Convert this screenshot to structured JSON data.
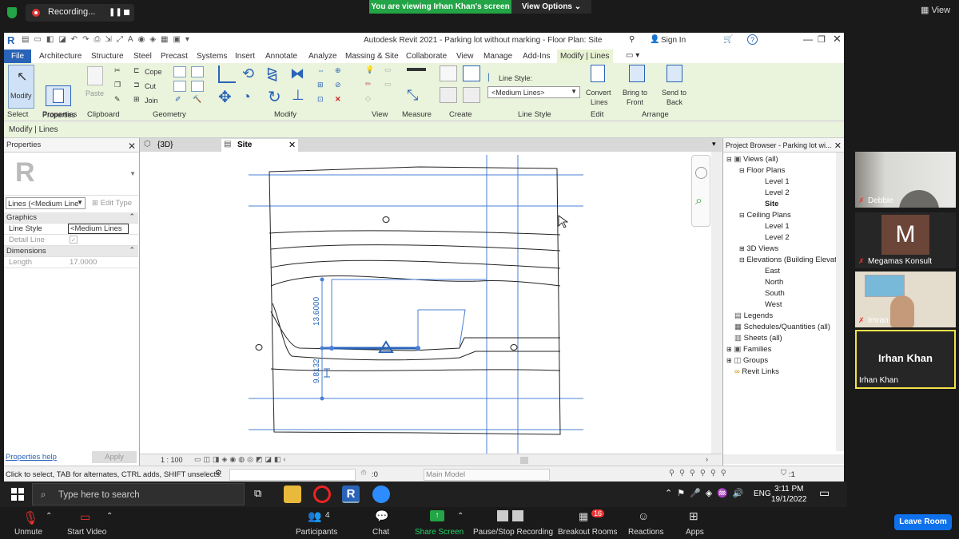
{
  "zoom": {
    "recording": "Recording...",
    "viewing_banner": "You are viewing Irhan Khan's screen",
    "view_options": "View Options",
    "view_label": "View",
    "leave_room": "Leave Room",
    "bottom": {
      "unmute": "Unmute",
      "start_video": "Start Video",
      "participants": "Participants",
      "participants_count": "4",
      "chat": "Chat",
      "share_screen": "Share Screen",
      "pause_stop": "Pause/Stop Recording",
      "breakout": "Breakout Rooms",
      "breakout_badge": "16",
      "reactions": "Reactions",
      "apps": "Apps"
    },
    "participants": [
      {
        "name": "Debbie",
        "avatar": ""
      },
      {
        "name": "Megamas Konsult",
        "avatar": "M"
      },
      {
        "name": "Imran",
        "avatar": ""
      },
      {
        "name": "Irhan Khan",
        "avatar": "Irhan Khan"
      }
    ]
  },
  "revit": {
    "title": "Autodesk Revit 2021 - Parking lot without marking - Floor Plan: Site",
    "sign_in": "Sign In",
    "tabs": [
      "File",
      "Architecture",
      "Structure",
      "Steel",
      "Precast",
      "Systems",
      "Insert",
      "Annotate",
      "Analyze",
      "Massing & Site",
      "Collaborate",
      "View",
      "Manage",
      "Add-Ins",
      "Modify | Lines"
    ],
    "ribbon": {
      "modify": "Modify",
      "properties": "Properties",
      "paste": "Paste",
      "cope": "Cope",
      "cut": "Cut",
      "join": "Join",
      "line_style_label": "Line Style:",
      "line_style_value": "<Medium Lines>",
      "convert_lines": "Convert\nLines",
      "convert_line1": "Convert",
      "convert_line2": "Lines",
      "bring_to_front1": "Bring to",
      "bring_to_front2": "Front",
      "send_to_back1": "Send to",
      "send_to_back2": "Back",
      "groups": [
        "Select",
        "Properties",
        "Clipboard",
        "Geometry",
        "Modify",
        "View",
        "Measure",
        "Create",
        "Line Style",
        "Edit",
        "Arrange"
      ]
    },
    "options_bar": "Modify | Lines",
    "properties": {
      "title": "Properties",
      "type_selector": "Lines (<Medium Line",
      "edit_type": "Edit Type",
      "graphics": "Graphics",
      "line_style_name": "Line Style",
      "line_style_val": "<Medium Lines",
      "detail_line": "Detail Line",
      "dimensions": "Dimensions",
      "length_name": "Length",
      "length_val": "17.0000",
      "help": "Properties help",
      "apply": "Apply"
    },
    "view_tabs": {
      "tab1": "{3D}",
      "tab2": "Site"
    },
    "dims": {
      "d1": "13.6000",
      "d2": "9.8132"
    },
    "scale": "1 : 100",
    "browser": {
      "title": "Project Browser - Parking lot wi...",
      "items": [
        {
          "label": "Views (all)"
        },
        {
          "label": "Floor Plans"
        },
        {
          "label": "Level 1"
        },
        {
          "label": "Level 2"
        },
        {
          "label": "Site"
        },
        {
          "label": "Ceiling Plans"
        },
        {
          "label": "Level 1"
        },
        {
          "label": "Level 2"
        },
        {
          "label": "3D Views"
        },
        {
          "label": "Elevations (Building Elevation)"
        },
        {
          "label": "East"
        },
        {
          "label": "North"
        },
        {
          "label": "South"
        },
        {
          "label": "West"
        },
        {
          "label": "Legends"
        },
        {
          "label": "Schedules/Quantities (all)"
        },
        {
          "label": "Sheets (all)"
        },
        {
          "label": "Families"
        },
        {
          "label": "Groups"
        },
        {
          "label": "Revit Links"
        }
      ]
    },
    "status": {
      "hint": "Click to select, TAB for alternates, CTRL adds, SHIFT unselects.",
      "zero": ":0",
      "model": "Main Model",
      "filter": ":1"
    }
  },
  "taskbar": {
    "search_placeholder": "Type here to search",
    "lang": "ENG",
    "time": "3:11 PM",
    "date": "19/1/2022"
  },
  "colors": {
    "zoom_green": "#23a446",
    "revit_blue": "#2a64b8",
    "ribbon_bg": "#eaf3dc",
    "leave_blue": "#0e71eb",
    "active_speaker": "#f2e24a"
  }
}
